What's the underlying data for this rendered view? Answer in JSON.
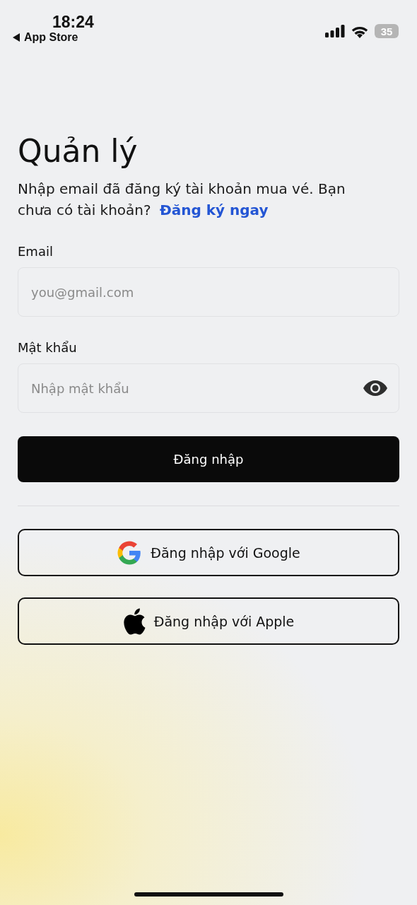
{
  "status_bar": {
    "time": "18:24",
    "back_label": "App Store",
    "battery": "35"
  },
  "title": "Quản lý",
  "intro": {
    "text": "Nhập email đã đăng ký tài khoản mua vé. Bạn chưa có tài khoản?",
    "link": "Đăng ký ngay"
  },
  "fields": [
    {
      "label": "Email",
      "placeholder": "you@gmail.com",
      "kind": "email"
    },
    {
      "label": "Mật khẩu",
      "placeholder": "Nhập mật khẩu",
      "kind": "password"
    }
  ],
  "login_button": "Đăng nhập",
  "social_buttons": [
    {
      "kind": "google",
      "label": "Đăng nhập với Google"
    },
    {
      "kind": "apple",
      "label": "Đăng nhập với Apple"
    }
  ]
}
